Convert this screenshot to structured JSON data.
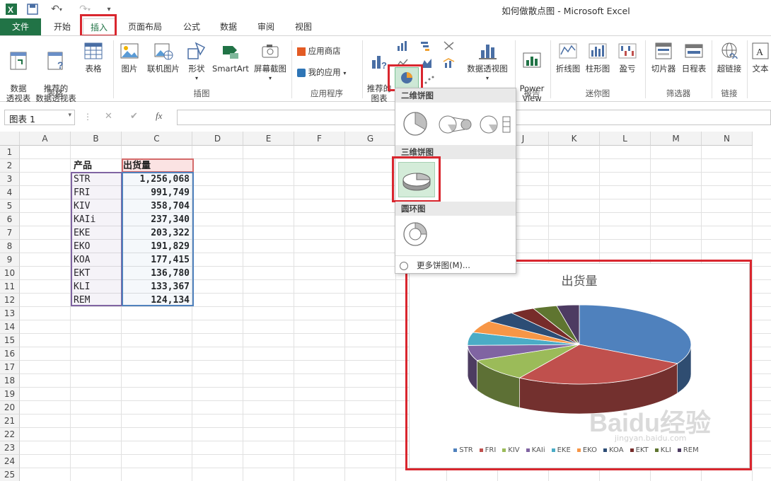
{
  "window": {
    "title": "如何做散点图 - Microsoft Excel"
  },
  "tabs": [
    {
      "label": "文件"
    },
    {
      "label": "开始"
    },
    {
      "label": "插入"
    },
    {
      "label": "页面布局"
    },
    {
      "label": "公式"
    },
    {
      "label": "数据"
    },
    {
      "label": "审阅"
    },
    {
      "label": "视图"
    }
  ],
  "ribbon": {
    "pivot_table": "数据\n透视表",
    "recommended_pivot": "推荐的\n数据透视表",
    "table": "表格",
    "group_tables": "表格",
    "picture": "图片",
    "online_picture": "联机图片",
    "shapes": "形状",
    "smartart": "SmartArt",
    "screenshot": "屏幕截图",
    "group_illustrations": "插图",
    "app_store": "应用商店",
    "my_apps": "我的应用",
    "group_apps": "应用程序",
    "recommended_charts": "推荐的\n图表",
    "pivot_chart": "数据透视图",
    "power_view": "Power\nView",
    "group_reports": "报告",
    "sparkline_line": "折线图",
    "sparkline_column": "柱形图",
    "sparkline_winloss": "盈亏",
    "group_sparklines": "迷你图",
    "slicer": "切片器",
    "timeline": "日程表",
    "group_filters": "筛选器",
    "hyperlink": "超链接",
    "group_links": "链接",
    "textbox": "文本"
  },
  "formula_bar": {
    "namebox": "图表 1",
    "fx": "fx",
    "cancel": "✕",
    "enter": "✔"
  },
  "columns": [
    "A",
    "B",
    "C",
    "D",
    "E",
    "F",
    "G",
    "H",
    "I",
    "J",
    "K",
    "L",
    "M",
    "N"
  ],
  "rows": [
    "1",
    "2",
    "3",
    "4",
    "5",
    "6",
    "7",
    "8",
    "9",
    "10",
    "11",
    "12",
    "13",
    "14",
    "15",
    "16",
    "17",
    "18",
    "19",
    "20",
    "21",
    "22",
    "23",
    "24",
    "25",
    "26"
  ],
  "table": {
    "header_product": "产品",
    "header_shipment": "出货量",
    "data": [
      {
        "product": "STR",
        "value": "1,256,068"
      },
      {
        "product": "FRI",
        "value": "991,749"
      },
      {
        "product": "KIV",
        "value": "358,704"
      },
      {
        "product": "KAIi",
        "value": "237,340"
      },
      {
        "product": "EKE",
        "value": "203,322"
      },
      {
        "product": "EKO",
        "value": "191,829"
      },
      {
        "product": "KOA",
        "value": "177,415"
      },
      {
        "product": "EKT",
        "value": "136,780"
      },
      {
        "product": "KLI",
        "value": "133,367"
      },
      {
        "product": "REM",
        "value": "124,134"
      }
    ]
  },
  "dropdown": {
    "section_2d": "二维饼图",
    "section_3d": "三维饼图",
    "section_donut": "圆环图",
    "more": "更多饼图(M)..."
  },
  "chart_data": {
    "type": "pie",
    "title": "出货量",
    "categories": [
      "STR",
      "FRI",
      "KIV",
      "KAIi",
      "EKE",
      "EKO",
      "KOA",
      "EKT",
      "KLI",
      "REM"
    ],
    "values": [
      1256068,
      991749,
      358704,
      237340,
      203322,
      191829,
      177415,
      136780,
      133367,
      124134
    ],
    "colors": [
      "#4f81bd",
      "#c0504d",
      "#9bbb59",
      "#8064a2",
      "#4bacc6",
      "#f79646",
      "#2c4d75",
      "#772c2a",
      "#5f7530",
      "#4d3b62"
    ],
    "legend": "bottom"
  },
  "watermark": {
    "brand": "Baidu经验",
    "url": "jingyan.baidu.com"
  }
}
